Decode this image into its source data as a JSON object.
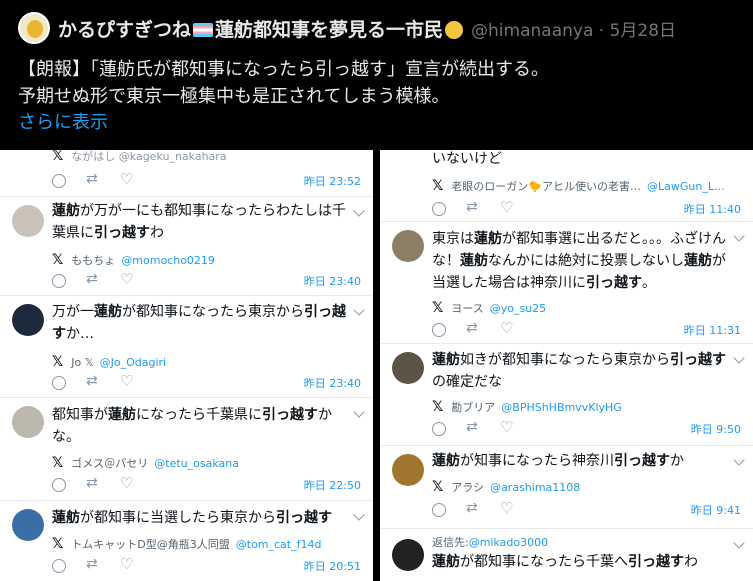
{
  "tweet": {
    "name_part1": "かるぴすぎつね",
    "name_part2": "蓮舫都知事を夢見る一市民",
    "handle": "@himanaanya",
    "date": "· 5月28日",
    "line1": "【朗報】「蓮舫氏が都知事になったら引っ越す」宣言が続出する。",
    "line2": "予期せぬ形で東京一極集中も是正されてしまう模様。",
    "show_more": "さらに表示"
  },
  "left": {
    "top_partial": {
      "source": "ながはし @kageku_nakahara",
      "time": "昨日 23:52"
    },
    "replies": [
      {
        "pre": "",
        "b1": "蓮舫",
        "mid": "が万が一にも都知事になったらわたしは千葉県に",
        "b2": "引っ越す",
        "post": "わ",
        "src_name": "ももちょ",
        "src_handle": "@momocho0219",
        "time": "昨日 23:40"
      },
      {
        "pre": "万が一",
        "b1": "蓮舫",
        "mid": "が都知事になったら東京から",
        "b2": "引っ越す",
        "post": "か…",
        "src_name": "Jo 𝕏",
        "src_handle": "@Jo_Odagiri",
        "time": "昨日 23:40"
      },
      {
        "pre": "都知事が",
        "b1": "蓮舫",
        "mid": "になったら千葉県に",
        "b2": "引っ越す",
        "post": "かな。",
        "src_name": "ゴメス＠パセリ",
        "src_handle": "@tetu_osakana",
        "time": "昨日 22:50"
      },
      {
        "pre": "",
        "b1": "蓮舫",
        "mid": "が都知事に当選したら東京から",
        "b2": "引っ越す",
        "post": "",
        "src_name": "トムキャットD型@角瓶3人同盟",
        "src_handle": "@tom_cat_f14d",
        "time": "昨日 20:51"
      }
    ]
  },
  "right": {
    "top_partial": {
      "text": "いないけど",
      "source": "老眼のローガン🐤アヒル使いの老害…",
      "handle": "@LawGun_L...",
      "time": "昨日 11:40"
    },
    "replies": [
      {
        "pre": "東京は",
        "b1": "蓮舫",
        "mid": "が都知事選に出るだと。。。ふざけんな！",
        "b1b": "蓮舫",
        "mid2": "なんかには絶対に投票しないし",
        "b1c": "蓮舫",
        "mid3": "が当選した場合は神奈川に",
        "b2": "引っ越す",
        "post": "。",
        "src_name": "ヨース",
        "src_handle": "@yo_su25",
        "time": "昨日 11:31"
      },
      {
        "pre": "",
        "b1": "蓮舫",
        "mid": "如きが都知事になったら東京から",
        "b2": "引っ越す",
        "post": "の確定だな",
        "src_name": "勘ブリア",
        "src_handle": "@BPHShHBmvvKlyHG",
        "time": "昨日 9:50"
      },
      {
        "pre": "",
        "b1": "蓮舫",
        "mid": "が知事になったら神奈川",
        "b2": "引っ越す",
        "post": "か",
        "src_name": "アラシ",
        "src_handle": "@arashima1108",
        "time": "昨日 9:41"
      }
    ],
    "last": {
      "reply_to_label": "返信先:",
      "reply_to_handle": "@mikado3000",
      "b1": "蓮舫",
      "mid": "が都知事になったら千葉へ",
      "b2": "引っ越す",
      "post": "わ"
    }
  }
}
